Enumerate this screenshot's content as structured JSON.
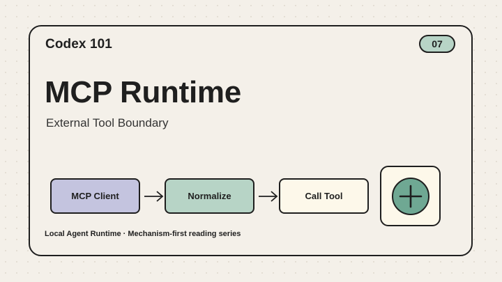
{
  "header": {
    "brand": "Codex 101",
    "badge": "07"
  },
  "hero": {
    "title": "MCP Runtime",
    "subtitle": "External Tool Boundary"
  },
  "flow": {
    "steps": [
      {
        "label": "MCP Client",
        "color": "#c4c4df"
      },
      {
        "label": "Normalize",
        "color": "#b7d4c6"
      },
      {
        "label": "Call Tool",
        "color": "#fdf8ea"
      }
    ],
    "end_icon": "plus-circle-icon"
  },
  "footer": {
    "text": "Local Agent Runtime · Mechanism-first reading series"
  },
  "colors": {
    "background": "#f4f0e9",
    "border": "#1e1e1e",
    "accent_green": "#b7d4c6",
    "accent_lavender": "#c4c4df",
    "cream": "#fdf8ea"
  }
}
